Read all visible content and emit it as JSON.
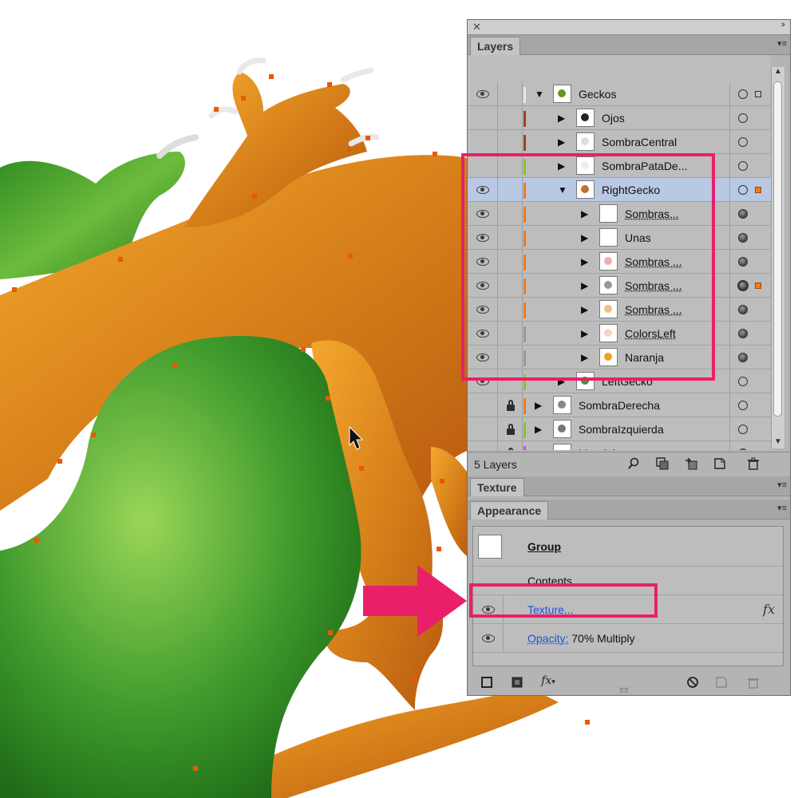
{
  "panel": {
    "close_glyph": "✕",
    "collapse_glyph": "››",
    "layers_tab": "Layers",
    "texture_tab": "Texture",
    "appearance_tab": "Appearance",
    "menu_glyph": "▾≡"
  },
  "layers": [
    {
      "name": "Geckos",
      "indent": 0,
      "expand": "▼",
      "eye": true,
      "lock": false,
      "color": "#e8e8e8",
      "thumb": "#5a9a2a",
      "underline": false,
      "target": "circle",
      "selbox": "square",
      "selected": false
    },
    {
      "name": "Ojos",
      "indent": 1,
      "expand": "▶",
      "eye": false,
      "lock": false,
      "color": "#a0401e",
      "thumb": "#222222",
      "underline": false,
      "target": "circle",
      "selbox": "",
      "selected": false
    },
    {
      "name": "SombraCentral",
      "indent": 1,
      "expand": "▶",
      "eye": false,
      "lock": false,
      "color": "#a0401e",
      "thumb": "#dddddd",
      "underline": false,
      "target": "circle",
      "selbox": "",
      "selected": false
    },
    {
      "name": "SombraPataDe...",
      "indent": 1,
      "expand": "▶",
      "eye": false,
      "lock": false,
      "color": "#8ac42a",
      "thumb": "#eeeeee",
      "underline": false,
      "target": "circle",
      "selbox": "",
      "selected": false
    },
    {
      "name": "RightGecko",
      "indent": 1,
      "expand": "▼",
      "eye": true,
      "lock": false,
      "color": "#f27a1a",
      "thumb": "#c07030",
      "underline": false,
      "target": "circle",
      "selbox": "orange",
      "selected": true
    },
    {
      "name": "Sombras...",
      "indent": 2,
      "expand": "▶",
      "eye": true,
      "lock": false,
      "color": "#f27a1a",
      "thumb": "#ffffff",
      "underline": true,
      "target": "filled",
      "selbox": "",
      "selected": false
    },
    {
      "name": "Unas",
      "indent": 2,
      "expand": "▶",
      "eye": true,
      "lock": false,
      "color": "#f27a1a",
      "thumb": "#ffffff",
      "underline": false,
      "target": "filled",
      "selbox": "",
      "selected": false
    },
    {
      "name": "Sombras ...",
      "indent": 2,
      "expand": "▶",
      "eye": true,
      "lock": false,
      "color": "#f27a1a",
      "thumb": "#f0b0b0",
      "underline": true,
      "target": "filled",
      "selbox": "",
      "selected": false
    },
    {
      "name": "Sombras ...",
      "indent": 2,
      "expand": "▶",
      "eye": true,
      "lock": false,
      "color": "#f27a1a",
      "thumb": "#999999",
      "underline": true,
      "target": "ring",
      "selbox": "orange",
      "selected": false
    },
    {
      "name": "Sombras ...",
      "indent": 2,
      "expand": "▶",
      "eye": true,
      "lock": false,
      "color": "#f27a1a",
      "thumb": "#f0c080",
      "underline": true,
      "target": "filled",
      "selbox": "",
      "selected": false
    },
    {
      "name": "ColorsLeft",
      "indent": 2,
      "expand": "▶",
      "eye": true,
      "lock": false,
      "color": "#999999",
      "thumb": "#f5d5c5",
      "underline": true,
      "target": "filled",
      "selbox": "",
      "selected": false
    },
    {
      "name": "Naranja",
      "indent": 2,
      "expand": "▶",
      "eye": true,
      "lock": false,
      "color": "#999999",
      "thumb": "#f0a020",
      "underline": false,
      "target": "filled",
      "selbox": "",
      "selected": false
    },
    {
      "name": "LeftGecko",
      "indent": 1,
      "expand": "▶",
      "eye": true,
      "lock": false,
      "color": "#8ac42a",
      "thumb": "#3a9a2a",
      "underline": false,
      "target": "circle",
      "selbox": "",
      "selected": false
    },
    {
      "name": "SombraDerecha",
      "indent": 0,
      "expand": "▶",
      "eye": false,
      "lock": true,
      "color": "#f27a1a",
      "thumb": "#888888",
      "underline": false,
      "target": "circle",
      "selbox": "",
      "selected": false
    },
    {
      "name": "SombraIzquierda",
      "indent": 0,
      "expand": "▶",
      "eye": false,
      "lock": true,
      "color": "#8ac42a",
      "thumb": "#777777",
      "underline": false,
      "target": "circle",
      "selbox": "",
      "selected": false
    },
    {
      "name": "Mandala",
      "indent": 0,
      "expand": "▶",
      "eye": false,
      "lock": true,
      "color": "#d04ae0",
      "thumb": "#ffffff",
      "underline": false,
      "target": "filled",
      "selbox": "",
      "selected": false
    }
  ],
  "layers_footer": {
    "count": "5 Layers",
    "icons": [
      "search-icon",
      "make-clipping-mask-icon",
      "move-to-layer-icon",
      "new-sublayer-icon",
      "new-layer-icon",
      "trash-icon"
    ]
  },
  "appearance": {
    "group_label": "Group",
    "contents_label": "Contents",
    "texture_label": "Texture...",
    "opacity_link": "Opacity:",
    "opacity_value": "70% Multiply",
    "fx_glyph": "fx"
  },
  "colors": {
    "highlight": "#ea1f6a",
    "link": "#1a55d1",
    "selected_row": "#b9c9e4",
    "gecko_orange": "#e08a20",
    "gecko_green": "#3e9a2c"
  }
}
